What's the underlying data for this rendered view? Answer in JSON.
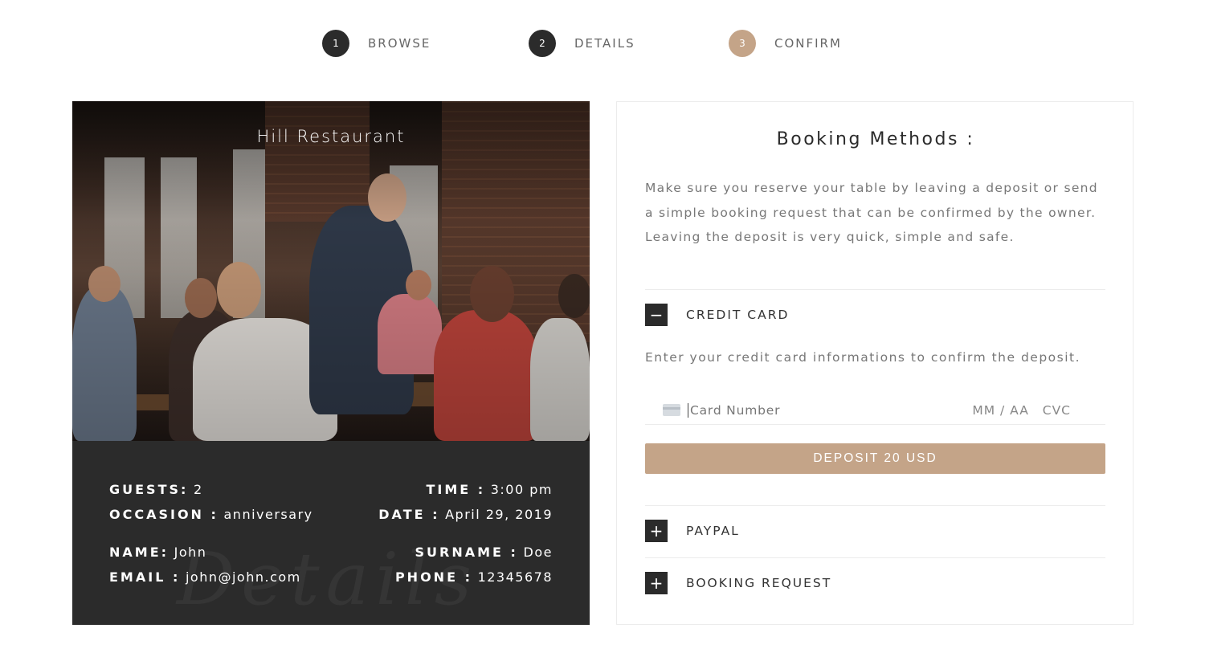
{
  "steps": [
    {
      "number": "1",
      "label": "BROWSE"
    },
    {
      "number": "2",
      "label": "DETAILS"
    },
    {
      "number": "3",
      "label": "CONFIRM"
    }
  ],
  "restaurant": {
    "name": "Hill Restaurant",
    "watermark": "Details"
  },
  "details": {
    "guests": {
      "key": "GUESTS:",
      "value": "2"
    },
    "occasion": {
      "key": "OCCASION :",
      "value": "anniversary"
    },
    "time": {
      "key": "TIME :",
      "value": "3:00 pm"
    },
    "date": {
      "key": "DATE :",
      "value": "April 29, 2019"
    },
    "name": {
      "key": "NAME:",
      "value": "John"
    },
    "surname": {
      "key": "SURNAME :",
      "value": "Doe"
    },
    "email": {
      "key": "EMAIL :",
      "value": "john@john.com"
    },
    "phone": {
      "key": "PHONE :",
      "value": "12345678"
    }
  },
  "booking": {
    "title": "Booking Methods :",
    "description": "Make sure you reserve your table by leaving a deposit or send a simple booking request that can be confirmed by the owner. Leaving the deposit is very quick, simple and safe.",
    "methods": {
      "credit_card": {
        "label": "CREDIT CARD",
        "toggle": "−"
      },
      "paypal": {
        "label": "PAYPAL",
        "toggle": "+"
      },
      "booking_request": {
        "label": "BOOKING REQUEST",
        "toggle": "+"
      }
    },
    "credit_card_hint": "Enter your credit card informations to confirm the deposit.",
    "card_number_placeholder": "Card Number",
    "expiry_placeholder": "MM / AA",
    "cvc_placeholder": "CVC",
    "deposit_button": "DEPOSIT 20 USD"
  },
  "colors": {
    "accent": "#c4a488",
    "dark": "#2b2b2b"
  }
}
